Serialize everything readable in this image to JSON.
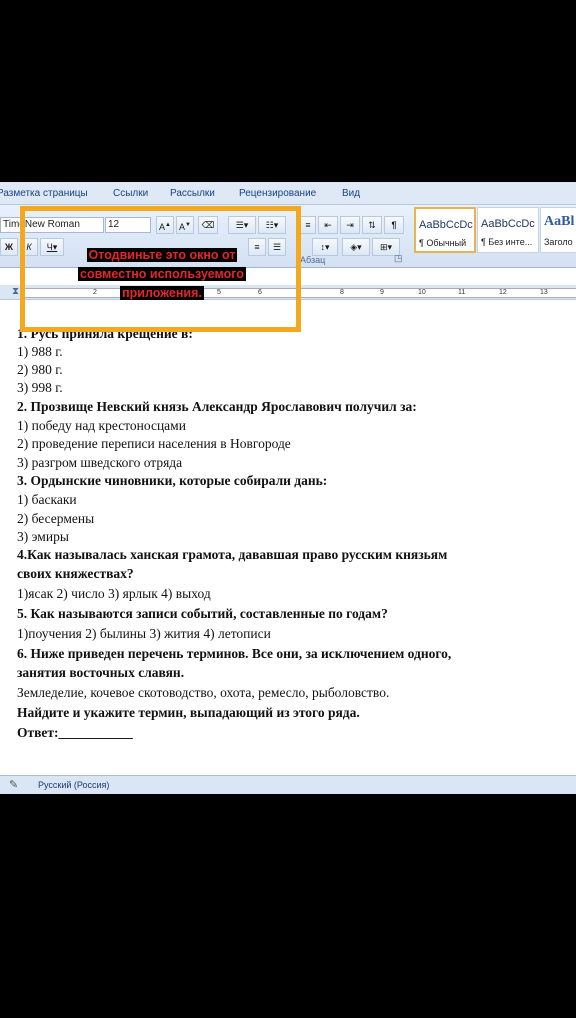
{
  "ribbon_tabs": [
    "Разметка страницы",
    "Ссылки",
    "Рассылки",
    "Рецензирование",
    "Вид"
  ],
  "font": {
    "name": "New Roman",
    "name_prefix": "Time",
    "size": "12"
  },
  "paragraph_group_label": "Абзац",
  "styles": [
    {
      "sample": "AaBbCcDc",
      "name": "¶ Обычный"
    },
    {
      "sample": "AaBbCcDc",
      "name": "¶ Без инте..."
    },
    {
      "sample": "AaBl",
      "name": "Заголо"
    }
  ],
  "ruler_numbers": [
    "2",
    "5",
    "6",
    "8",
    "9",
    "10",
    "11",
    "12",
    "13"
  ],
  "overlay": {
    "lines": [
      "Отодвиньте это окно от",
      "совместно используемого",
      "приложения."
    ],
    "color": "#f4a81e"
  },
  "document": {
    "lines": [
      "1. Русь приняла крещение в:",
      "1) 988 г.",
      "2) 980 г.",
      "3) 998 г.",
      "2. Прозвище Невский князь Александр Ярославович получил за:",
      "1) победу над крестоносцами",
      "2) проведение переписи населения в Новгороде",
      "3) разгром шведского отряда",
      "3. Ордынские чиновники, которые собирали дань:",
      "1) баскаки",
      "2) бесермены",
      "3) эмиры",
      "4.Как называлась ханская грамота, дававшая право русским князьям",
      "своих княжествах?",
      "1)ясак 2) число 3) ярлык 4) выход",
      "5. Как называются записи событий, составленные по годам?",
      "1)поучения 2) былины 3) жития 4) летописи",
      "6. Ниже приведен перечень терминов. Все они, за исключением одного,",
      "занятия восточных славян.",
      "Земледелие, кочевое скотоводство, охота, ремесло, рыболовство.",
      "Найдите и укажите термин, выпадающий из этого ряда.",
      "Ответ:___________"
    ]
  },
  "status_bar": {
    "language": "Русский (Россия)"
  }
}
